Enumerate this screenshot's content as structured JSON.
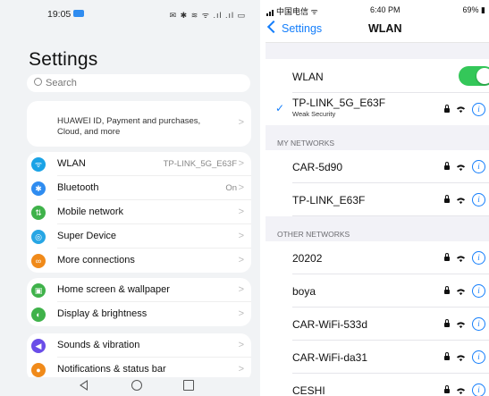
{
  "left": {
    "status": {
      "time": "19:05",
      "icons": "✉ ✱ ≋ ᯤ .ıl .ıl ▭"
    },
    "title": "Settings",
    "search_placeholder": "Search",
    "huawei_id": "HUAWEI ID, Payment and purchases, Cloud, and more",
    "group1": [
      {
        "label": "WLAN",
        "value": "TP-LINK_5G_E63F",
        "icon": "wifi-icon",
        "color": "#1aa3e6"
      },
      {
        "label": "Bluetooth",
        "value": "On",
        "icon": "bluetooth-icon",
        "color": "#2f8cf0"
      },
      {
        "label": "Mobile network",
        "value": "",
        "icon": "mobile-network-icon",
        "color": "#3fb24a"
      },
      {
        "label": "Super Device",
        "value": "",
        "icon": "super-device-icon",
        "color": "#27a6e4"
      },
      {
        "label": "More connections",
        "value": "",
        "icon": "link-icon",
        "color": "#f08a1a"
      }
    ],
    "group2": [
      {
        "label": "Home screen & wallpaper",
        "value": "",
        "icon": "wallpaper-icon",
        "color": "#3fb24a"
      },
      {
        "label": "Display & brightness",
        "value": "",
        "icon": "display-icon",
        "color": "#3fb24a"
      }
    ],
    "group3": [
      {
        "label": "Sounds & vibration",
        "value": "",
        "icon": "sound-icon",
        "color": "#6a4de8"
      },
      {
        "label": "Notifications & status bar",
        "value": "",
        "icon": "notification-icon",
        "color": "#f08a1a"
      }
    ]
  },
  "right": {
    "status": {
      "carrier": "中国电信",
      "time": "6:40 PM",
      "battery": "69%"
    },
    "back_label": "Settings",
    "title": "WLAN",
    "wlan_label": "WLAN",
    "wlan_on": true,
    "connected": {
      "name": "TP-LINK_5G_E63F",
      "sub": "Weak Security"
    },
    "my_networks_header": "MY NETWORKS",
    "my_networks": [
      "CAR-5d90",
      "TP-LINK_E63F"
    ],
    "other_networks_header": "OTHER NETWORKS",
    "other_networks": [
      "20202",
      "boya",
      "CAR-WiFi-533d",
      "CAR-WiFi-da31",
      "CESHI"
    ],
    "accent": "#147efb",
    "toggle_color": "#34c759"
  }
}
